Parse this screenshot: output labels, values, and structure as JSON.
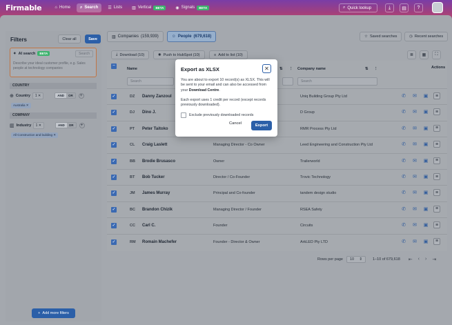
{
  "nav": {
    "logo": "Firmable",
    "items": [
      {
        "label": "Home",
        "icon": "home-icon"
      },
      {
        "label": "Search",
        "icon": "search-icon"
      },
      {
        "label": "Lists",
        "icon": "list-icon"
      },
      {
        "label": "Vertical",
        "icon": "building-icon",
        "badge": "BETA"
      },
      {
        "label": "Signals",
        "icon": "signal-icon",
        "badge": "BETA"
      }
    ],
    "quick_lookup": "Quick lookup"
  },
  "filters": {
    "title": "Filters",
    "clear_all": "Clear all",
    "save": "Save",
    "ai_search": {
      "label": "AI search",
      "badge": "BETA",
      "search_button": "Search",
      "placeholder": "Describe your ideal customer profile, e.g. Sales people at technology companies"
    },
    "country_section": "COUNTRY",
    "country": {
      "label": "Country",
      "count": "1",
      "and": "AND",
      "or": "OR",
      "chip": "Australia"
    },
    "company_section": "COMPANY",
    "industry": {
      "label": "Industry",
      "count": "1",
      "and": "AND",
      "or": "OR",
      "chip": "All Construction and building"
    },
    "add_more": "Add more filters"
  },
  "tabs": {
    "companies": "Companies",
    "companies_count": "(159,939)",
    "people": "People",
    "people_count": "(679,618)",
    "saved_searches": "Saved searches",
    "recent_searches": "Recent searches"
  },
  "actions": {
    "download": "Download (10)",
    "push_hubspot": "Push to HubSpot (10)",
    "add_to_list": "Add to list (10)"
  },
  "table": {
    "headers": {
      "name": "Name",
      "company": "Company name",
      "actions": "Actions"
    },
    "search_placeholder": "Search",
    "rows": [
      {
        "initials": "DZ",
        "name": "Danny Zanzoul",
        "title": "",
        "company": "Uniq Building Group Pty Ltd"
      },
      {
        "initials": "DJ",
        "name": "Dino J.",
        "title": "",
        "company": "D Group"
      },
      {
        "initials": "PT",
        "name": "Peter Taitoko",
        "title": "",
        "company": "RMR Process Pty Ltd"
      },
      {
        "initials": "CL",
        "name": "Craig Laslett",
        "title": "Managing Director - Co Owner",
        "company": "Leed Engineering and Construction Pty Ltd"
      },
      {
        "initials": "BB",
        "name": "Brodie Brusasco",
        "title": "Owner",
        "company": "Trailerworld"
      },
      {
        "initials": "BT",
        "name": "Bob Tucker",
        "title": "Director / Co-Founder",
        "company": "Trovic Technology"
      },
      {
        "initials": "JM",
        "name": "James Murray",
        "title": "Principal and Co-founder",
        "company": "tandem design studio"
      },
      {
        "initials": "BC",
        "name": "Brandon Chizik",
        "title": "Managing Director / Founder",
        "company": "RSEA Safety"
      },
      {
        "initials": "CC",
        "name": "Carl C.",
        "title": "Founder",
        "company": "Circuits"
      },
      {
        "initials": "RM",
        "name": "Romain Machefer",
        "title": "Founder - Director & Owner",
        "company": "ArkLED Pty LTD"
      }
    ]
  },
  "pager": {
    "rows_per_page": "Rows per page",
    "value": "10",
    "range": "1–10 of 679,618"
  },
  "modal": {
    "title": "Export as XLSX",
    "text1_a": "You are about to export 10 record(s) as XLSX. This will be sent to your email and can also be accessed from your ",
    "text1_b": "Download Centre",
    "text1_c": ".",
    "text2": "Each export uses 1 credit per record (except records previously downloaded).",
    "checkbox": "Exclude previously downloaded records",
    "cancel": "Cancel",
    "export": "Export"
  },
  "colors": {
    "accent": "#2b5fa8",
    "beta": "#3db36e"
  }
}
